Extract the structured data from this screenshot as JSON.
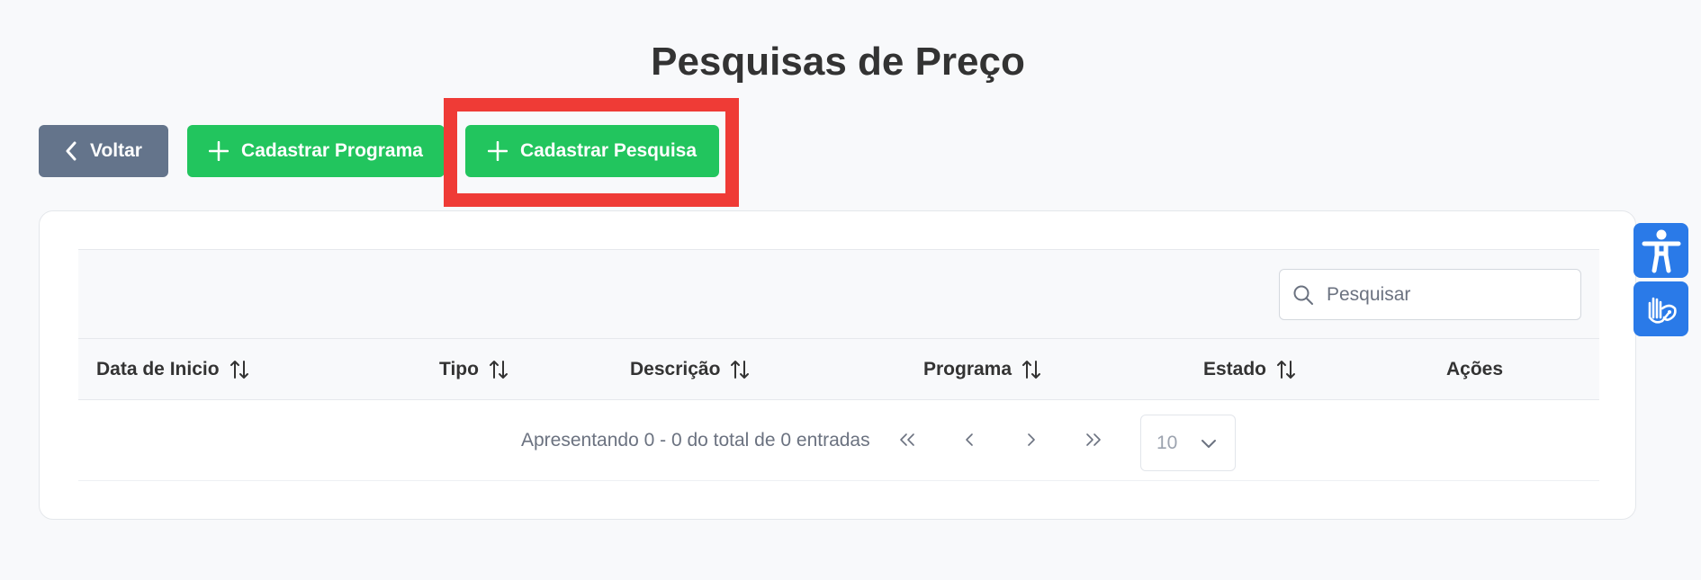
{
  "page": {
    "title": "Pesquisas de Preço"
  },
  "actions": {
    "back_label": "Voltar",
    "new_program_label": "Cadastrar Programa",
    "new_research_label": "Cadastrar Pesquisa"
  },
  "search": {
    "placeholder": "Pesquisar"
  },
  "table": {
    "columns": [
      {
        "label": "Data de Inicio"
      },
      {
        "label": "Tipo"
      },
      {
        "label": "Descrição"
      },
      {
        "label": "Programa"
      },
      {
        "label": "Estado"
      },
      {
        "label": "Ações"
      }
    ],
    "rows": []
  },
  "paginator": {
    "report": "Apresentando 0 - 0 do total de 0 entradas",
    "rows_per_page": "10"
  },
  "colors": {
    "back_button": "#64748b",
    "primary_green": "#22c55e",
    "highlight": "#ef3b36",
    "accessibility_blue": "#2a7ae8"
  },
  "icons": {
    "back": "chevron-left-icon",
    "add": "plus-icon",
    "search": "search-icon",
    "sort": "sort-icon",
    "first": "double-chevron-left-icon",
    "prev": "chevron-left-icon",
    "next": "chevron-right-icon",
    "last": "double-chevron-right-icon",
    "dropdown": "chevron-down-icon",
    "accessibility": "accessibility-icon",
    "sign_language": "sign-language-icon"
  }
}
